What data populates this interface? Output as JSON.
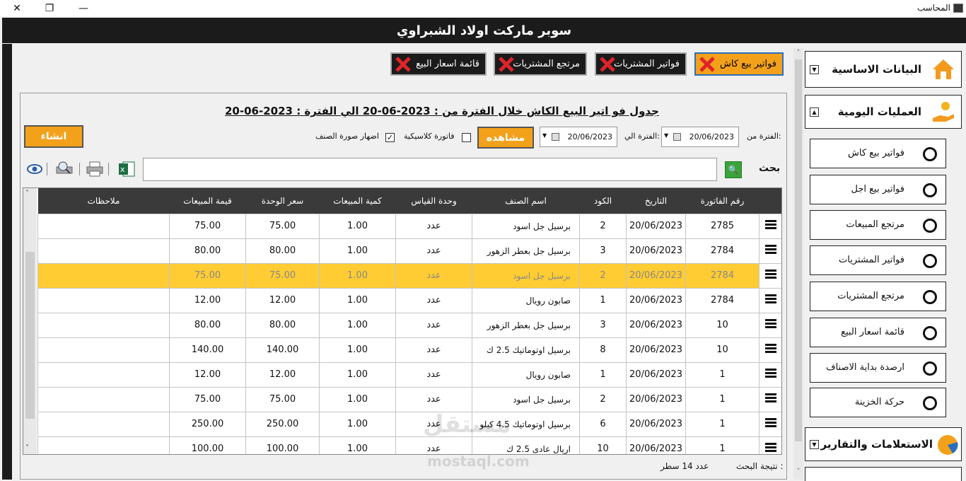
{
  "window": {
    "title": "المحاسب",
    "close": "✕",
    "maximize": "❐",
    "minimize": "—"
  },
  "header": {
    "title": "سوبر ماركت اولاد الشبراوي"
  },
  "sidebar": {
    "sections": [
      {
        "label": "البيانات الاساسية",
        "icon": "home-icon"
      },
      {
        "label": "العمليات اليومية",
        "icon": "hand-coins-icon"
      },
      {
        "label": "الاستعلامات والتقارير",
        "icon": "pie-chart-icon"
      }
    ],
    "items": [
      {
        "label": "فواتير بيع كاش"
      },
      {
        "label": "فواتير بيع اجل"
      },
      {
        "label": "مرتجع المبيعات"
      },
      {
        "label": "فواتير المشتريات"
      },
      {
        "label": "مرتجع المشتريات"
      },
      {
        "label": "قائمة اسعار البيع"
      },
      {
        "label": "ارصدة بداية الاصناف"
      },
      {
        "label": "حركة الخزينة"
      }
    ]
  },
  "tabs": [
    {
      "label": "فواتير بيع كاش",
      "active": true
    },
    {
      "label": "فواتير المشتريات",
      "active": false
    },
    {
      "label": "مرتجع المشتريات",
      "active": false
    },
    {
      "label": "قائمة اسعار البيع",
      "active": false
    }
  ],
  "filter": {
    "caption": "جدول فو اتير البيع الكاش خلال الفترة من : 2023-06-20 الي الفترة : 2023-06-20",
    "from_label": "الفترة من:",
    "from_value": "20/06/2023",
    "to_label": "الفترة الي:",
    "to_value": "20/06/2023",
    "view_button": "مشاهده",
    "classic_label": "فاتورة كلاسيكية",
    "classic_checked": false,
    "show_image_label": "اضهار صورة الصنف",
    "show_image_checked": true,
    "create_button": "انشاء"
  },
  "search": {
    "label": "بحث",
    "value": "",
    "placeholder": ""
  },
  "toolbar": {
    "icons": [
      "excel-icon",
      "print-icon",
      "print-preview-icon",
      "eye-icon"
    ]
  },
  "table": {
    "columns": [
      "رقم الفاتورة",
      "التاريخ",
      "الكود",
      "اسم الصنف",
      "وحدة القياس",
      "كمية المبيعات",
      "سعر الوحدة",
      "قيمة المبيعات",
      "ملاحظات"
    ],
    "rows": [
      [
        "2785",
        "20/06/2023",
        "2",
        "برسيل جل اسود",
        "عدد",
        "1.00",
        "75.00",
        "75.00",
        ""
      ],
      [
        "2784",
        "20/06/2023",
        "3",
        "برسيل جل بعطر الزهور",
        "عدد",
        "1.00",
        "80.00",
        "80.00",
        ""
      ],
      [
        "2784",
        "20/06/2023",
        "2",
        "برسيل جل اسود",
        "عدد",
        "1.00",
        "75.00",
        "75.00",
        ""
      ],
      [
        "2784",
        "20/06/2023",
        "1",
        "صابون رويال",
        "عدد",
        "1.00",
        "12.00",
        "12.00",
        ""
      ],
      [
        "10",
        "20/06/2023",
        "3",
        "برسيل جل بعطر الزهور",
        "عدد",
        "1.00",
        "80.00",
        "80.00",
        ""
      ],
      [
        "10",
        "20/06/2023",
        "8",
        "برسيل اوتوماتيك 2.5 ك",
        "عدد",
        "1.00",
        "140.00",
        "140.00",
        ""
      ],
      [
        "1",
        "20/06/2023",
        "1",
        "صابون رويال",
        "عدد",
        "1.00",
        "12.00",
        "12.00",
        ""
      ],
      [
        "1",
        "20/06/2023",
        "2",
        "برسيل جل اسود",
        "عدد",
        "1.00",
        "75.00",
        "75.00",
        ""
      ],
      [
        "1",
        "20/06/2023",
        "6",
        "برسيل اوتوماتيك 4.5 كيلو",
        "عدد",
        "1.00",
        "250.00",
        "250.00",
        ""
      ],
      [
        "1",
        "20/06/2023",
        "10",
        "اريال عادى 2.5 ك",
        "عدد",
        "1.00",
        "100.00",
        "100.00",
        ""
      ]
    ],
    "selected_row": 2
  },
  "status": {
    "result_label": "نتيجة البحث :",
    "result_value": "عدد 14 سطر"
  },
  "watermark": {
    "line1": "مستقل",
    "line2": "mostaql.com"
  }
}
